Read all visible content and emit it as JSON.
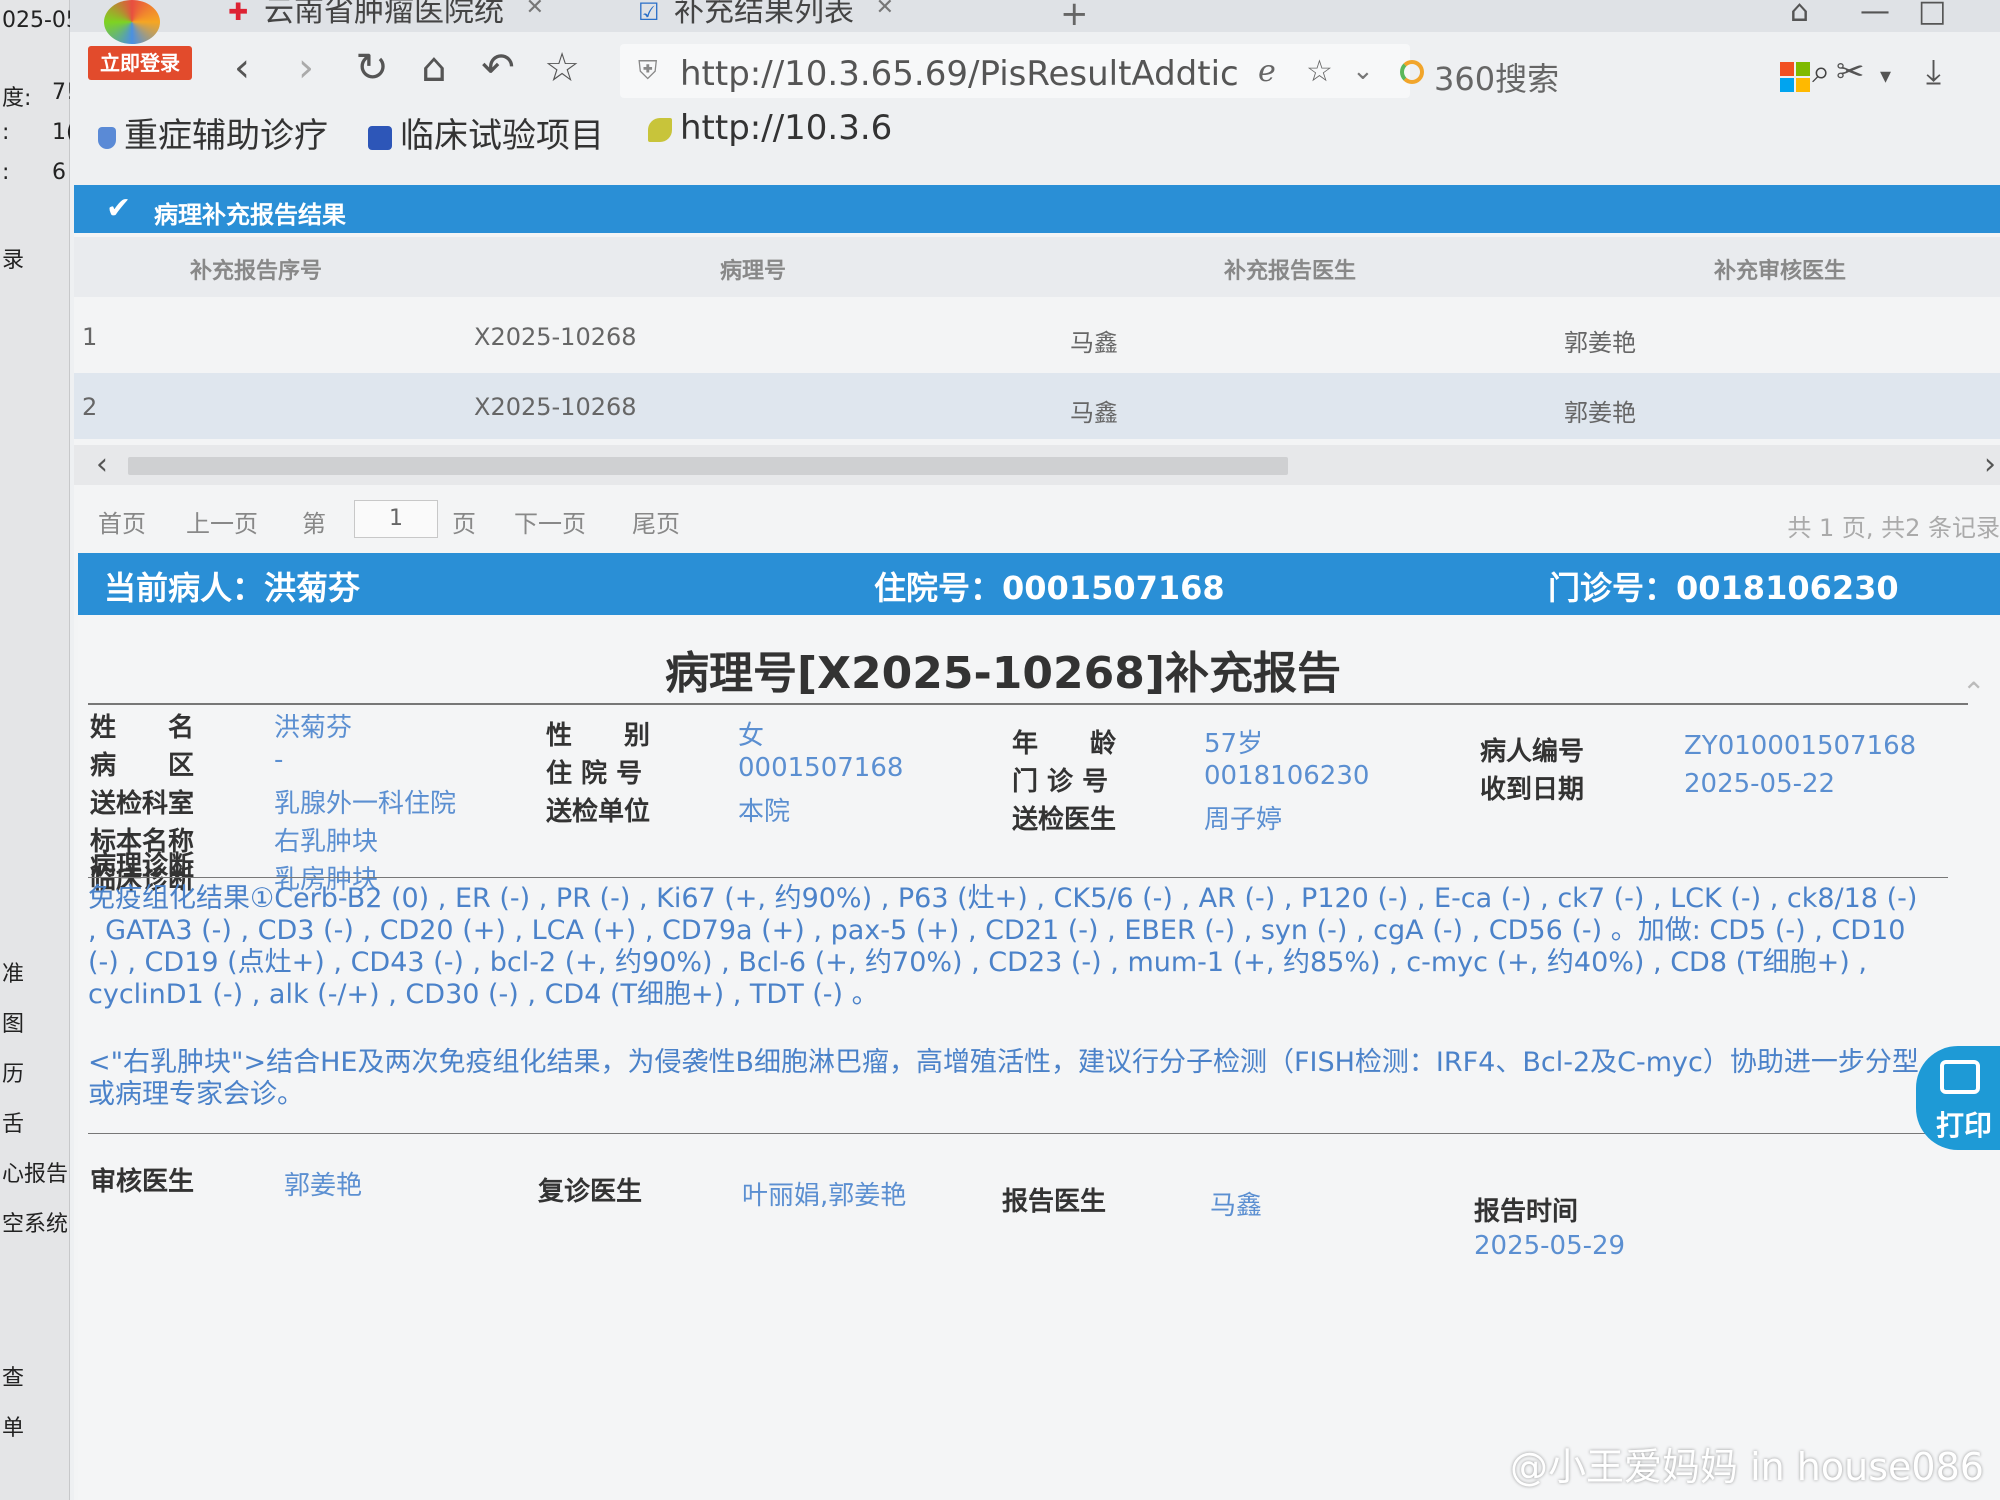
{
  "left_strip": [
    "025-05-",
    "度:",
    "7!",
    ":",
    "1(",
    ":",
    "6",
    "录",
    "准",
    "图",
    "历",
    "舌",
    "心报告",
    "空系统",
    "查",
    "单"
  ],
  "browser": {
    "tabs": [
      {
        "title": "云南省肿瘤医院统"
      },
      {
        "title": "补充结果列表"
      }
    ],
    "login_label": "立即登录",
    "url": "http://10.3.65.69/PisResultAddtic",
    "search_placeholder": "360搜索",
    "bookmarks": [
      "重症辅助诊疗",
      "临床试验项目",
      "http://10.3.6"
    ]
  },
  "panel": {
    "title": "病理补充报告结果",
    "columns": [
      "补充报告序号",
      "病理号",
      "补充报告医生",
      "补充审核医生"
    ],
    "rows": [
      {
        "seq": "1",
        "pathology_no": "X2025-10268",
        "report_doctor": "马鑫",
        "review_doctor": "郭姜艳"
      },
      {
        "seq": "2",
        "pathology_no": "X2025-10268",
        "report_doctor": "马鑫",
        "review_doctor": "郭姜艳"
      }
    ]
  },
  "pager": {
    "first": "首页",
    "prev": "上一页",
    "page_prefix": "第",
    "page_value": "1",
    "page_suffix": "页",
    "next": "下一页",
    "last": "尾页",
    "total": "共 1 页, 共2 条记录"
  },
  "patient_bar": {
    "current_patient": "当前病人：洪菊芬",
    "inpatient_no": "住院号：0001507168",
    "outpatient_no": "门诊号：0018106230"
  },
  "report": {
    "title": "病理号[X2025-10268]补充报告",
    "fields": {
      "name_label": "姓　　名",
      "name": "洪菊芬",
      "ward_label": "病　　区",
      "ward": "-",
      "dept_label": "送检科室",
      "dept": "乳腺外一科住院",
      "specimen_label": "标本名称",
      "specimen": "右乳肿块",
      "clinical_label": "临床诊断",
      "clinical": "乳房肿块",
      "sex_label": "性　　别",
      "sex": "女",
      "inpatient_label": "住 院 号",
      "inpatient": "0001507168",
      "unit_label": "送检单位",
      "unit": "本院",
      "age_label": "年　　龄",
      "age": "57岁",
      "outpatient_label": "门 诊 号",
      "outpatient": "0018106230",
      "sender_label": "送检医生",
      "sender": "周子婷",
      "patient_id_label": "病人编号",
      "patient_id": "ZY010001507168",
      "received_label": "收到日期",
      "received": "2025-05-22"
    },
    "diagnosis_label": "病理诊断",
    "diagnosis_text": "免疫组化结果①Cerb-B2 (0) , ER (-) , PR (-) , Ki67 (+, 约90%) , P63 (灶+) , CK5/6 (-) , AR (-) , P120 (-) , E-ca (-) , ck7 (-) , LCK (-) , ck8/18 (-) , GATA3 (-) , CD3 (-) , CD20 (+) , LCA (+) , CD79a (+) , pax-5 (+) , CD21 (-) , EBER (-) , syn (-) , cgA (-) , CD56 (-) 。加做: CD5 (-) , CD10 (-) , CD19 (点灶+) , CD43 (-) , bcl-2 (+, 约90%) , Bcl-6 (+, 约70%) , CD23 (-) , mum-1 (+, 约85%) , c-myc (+, 约40%) , CD8 (T细胞+) , cyclinD1 (-) , alk (-/+) , CD30 (-) , CD4 (T细胞+) , TDT (-) 。",
    "conclusion": "<\"右乳肿块\">结合HE及两次免疫组化结果，为侵袭性B细胞淋巴瘤，高增殖活性，建议行分子检测（FISH检测：IRF4、Bcl-2及C-myc）协助进一步分型或病理专家会诊。",
    "footer": {
      "reviewer_label": "审核医生",
      "reviewer": "郭姜艳",
      "recheck_label": "复诊医生",
      "recheck": "叶丽娟,郭姜艳",
      "reporter_label": "报告医生",
      "reporter": "马鑫",
      "report_time_label": "报告时间",
      "report_time": "2025-05-29"
    },
    "print_label": "打印"
  },
  "watermark": "@小王爱妈妈 in house086",
  "colors": {
    "accent_blue": "#2a8fd6",
    "value_blue": "#5b8fd1",
    "login_red": "#e24b2c"
  },
  "icons": [
    "browser-logo-icon",
    "back-icon",
    "forward-icon",
    "refresh-icon",
    "home-icon",
    "undo-icon",
    "star-icon",
    "shield-icon",
    "search-icon",
    "scissors-icon",
    "download-icon",
    "checkmark-icon",
    "printer-icon"
  ]
}
